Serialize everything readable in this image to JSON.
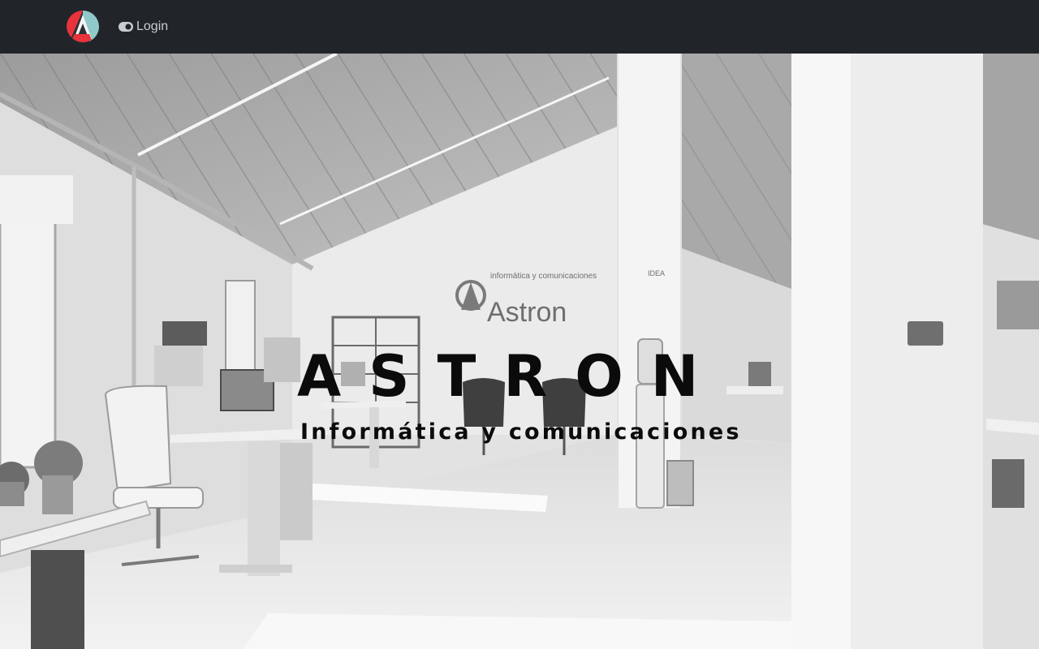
{
  "navbar": {
    "brand": {
      "logo_icon": "astron-logo-icon"
    },
    "login": {
      "label": "Login",
      "icon": "toggle-icon"
    },
    "colors": {
      "background": "#212529",
      "link": "#c9ccd0"
    }
  },
  "hero": {
    "title": "ASTRON",
    "subtitle": "Informática y comunicaciones",
    "background": {
      "kind": "grayscale office photo",
      "wall_sign": {
        "tagline": "informática y comunicaciones",
        "name": "Astron",
        "idea_label": "IDEA"
      }
    }
  }
}
